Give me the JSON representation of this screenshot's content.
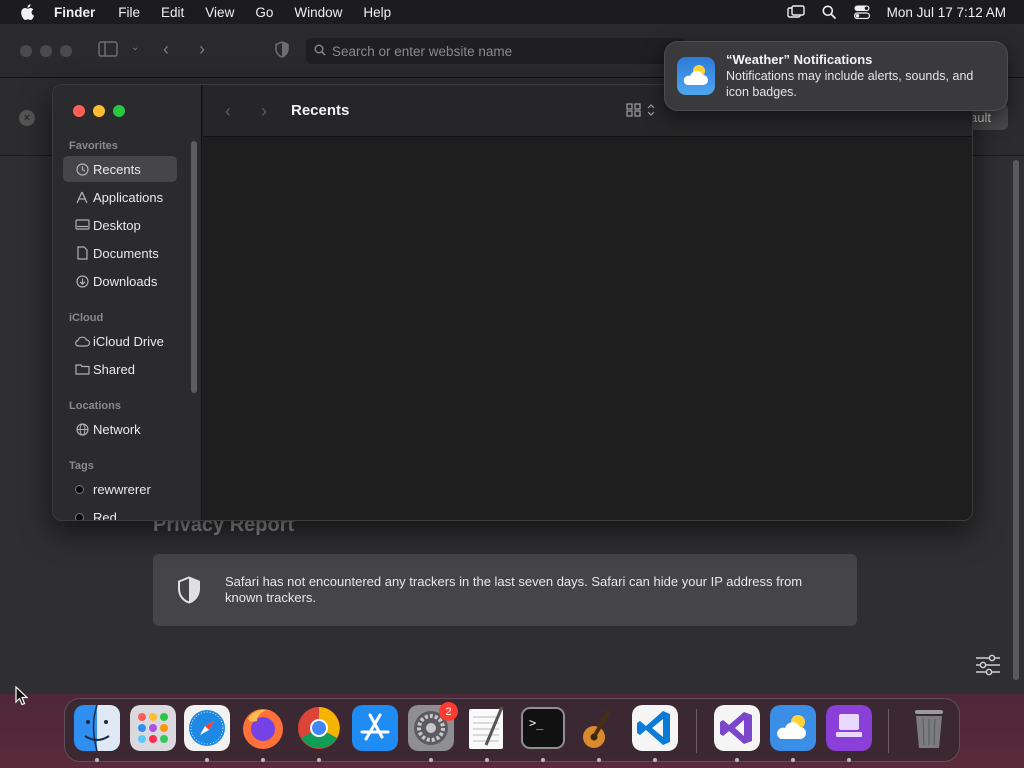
{
  "menubar": {
    "app_name": "Finder",
    "items": [
      "File",
      "Edit",
      "View",
      "Go",
      "Window",
      "Help"
    ],
    "clock": "Mon Jul 17  7:12 AM",
    "status_icons": [
      "screen-mirroring-icon",
      "spotlight-search-icon",
      "control-center-icon"
    ]
  },
  "safari": {
    "address_placeholder": "Search or enter website name",
    "default_button": "ault",
    "privacy_title": "Privacy Report",
    "privacy_text": "Safari has not encountered any trackers in the last seven days. Safari can hide your IP address from known trackers."
  },
  "finder": {
    "title": "Recents",
    "sections": {
      "favorites": "Favorites",
      "icloud": "iCloud",
      "locations": "Locations",
      "tags": "Tags"
    },
    "favorites": [
      {
        "label": "Recents",
        "icon": "clock-icon",
        "selected": true
      },
      {
        "label": "Applications",
        "icon": "applications-icon"
      },
      {
        "label": "Desktop",
        "icon": "desktop-icon"
      },
      {
        "label": "Documents",
        "icon": "document-icon"
      },
      {
        "label": "Downloads",
        "icon": "download-icon"
      }
    ],
    "icloud": [
      {
        "label": "iCloud Drive",
        "icon": "cloud-icon"
      },
      {
        "label": "Shared",
        "icon": "shared-folder-icon"
      }
    ],
    "locations": [
      {
        "label": "Network",
        "icon": "globe-icon"
      }
    ],
    "tags": [
      {
        "label": "rewwrerer"
      },
      {
        "label": "Red"
      }
    ]
  },
  "notification": {
    "title": "“Weather” Notifications",
    "body": "Notifications may include alerts, sounds, and icon badges."
  },
  "dock": {
    "apps": [
      "Finder",
      "Launchpad",
      "Safari",
      "Firefox",
      "Chrome",
      "App Store",
      "System Settings",
      "TextEdit",
      "Terminal",
      "GarageBand",
      "Visual Studio Code",
      "Visual Studio",
      "Weather",
      "Simulator",
      "Trash"
    ],
    "settings_badge": "2"
  }
}
